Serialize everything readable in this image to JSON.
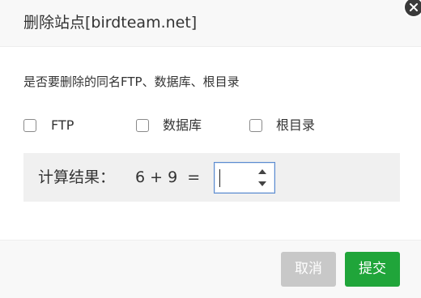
{
  "dialog": {
    "title": "删除站点[birdteam.net]",
    "question": "是否要删除的同名FTP、数据库、根目录",
    "options": [
      {
        "label": "FTP",
        "checked": false
      },
      {
        "label": "数据库",
        "checked": false
      },
      {
        "label": "根目录",
        "checked": false
      }
    ],
    "captcha": {
      "label": "计算结果：",
      "expression": "6 + 9  =",
      "answer": ""
    },
    "buttons": {
      "cancel": "取消",
      "submit": "提交"
    }
  },
  "colors": {
    "submit": "#20a53a",
    "cancel": "#c8c8c8",
    "input_focus_border": "#5b8bd0"
  },
  "icons": {
    "close": "close-icon",
    "spin_up": "caret-up-icon",
    "spin_down": "caret-down-icon"
  }
}
